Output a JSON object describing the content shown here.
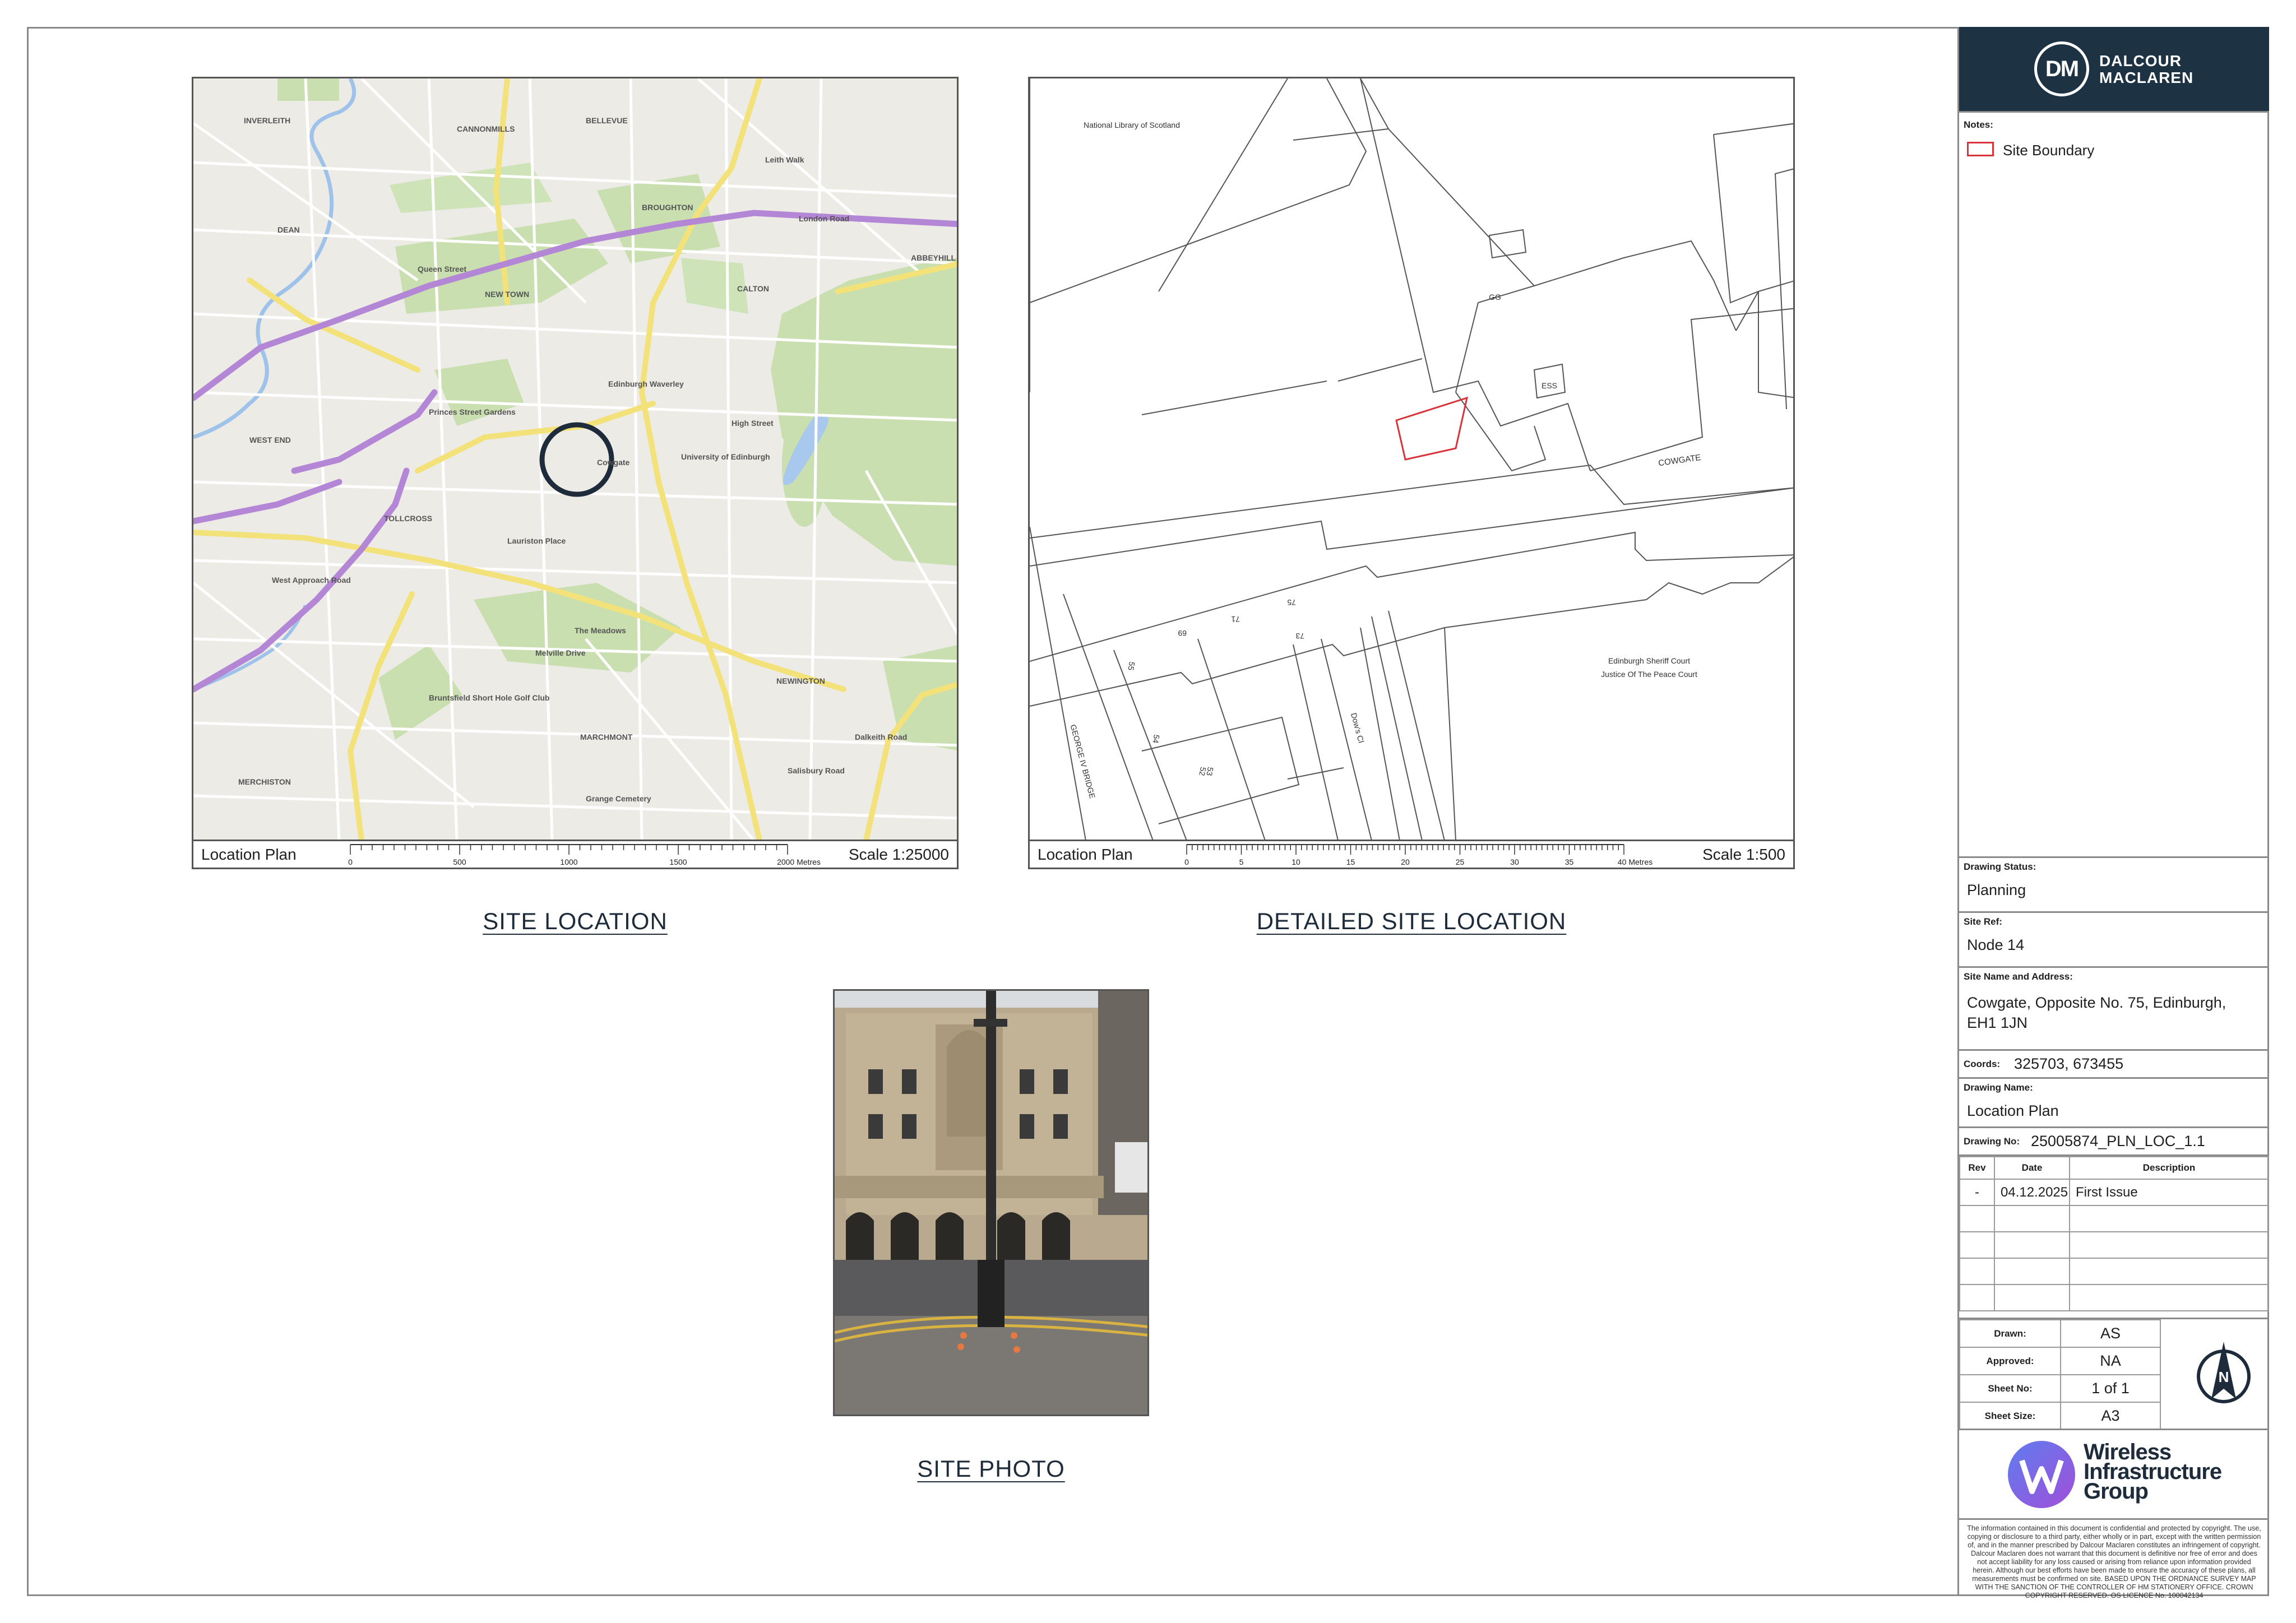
{
  "site_location": {
    "title": "SITE LOCATION",
    "plan_label": "Location Plan",
    "scale_label": "Scale 1:25000",
    "scale_ticks": [
      "0",
      "500",
      "1000",
      "1500",
      "2000 Metres"
    ],
    "map_labels": [
      "INVERLEITH",
      "CANNONMILLS",
      "BELLEVUE",
      "BROUGHTON",
      "DEAN",
      "NEW TOWN",
      "CALTON",
      "ABBEYHILL",
      "WEST END",
      "Princes Street Gardens",
      "Edinburgh Waverley",
      "University of Edinburgh",
      "TOLLCROSS",
      "The Meadows",
      "NEWINGTON",
      "MARCHMONT",
      "MERCHISTON",
      "Bruntsfield Short Hole Golf Club",
      "Queen Street",
      "Leith Walk",
      "London Road",
      "High Street",
      "Cowgate",
      "West Approach Road",
      "Melville Drive",
      "Grange Cemetery",
      "Lauriston Place",
      "Dalkeith Road",
      "Salisbury Road"
    ]
  },
  "detailed_location": {
    "title": "DETAILED SITE LOCATION",
    "plan_label": "Location Plan",
    "scale_label": "Scale 1:500",
    "scale_ticks": [
      "0",
      "5",
      "10",
      "15",
      "20",
      "25",
      "30",
      "35",
      "40 Metres"
    ],
    "map_labels": {
      "library": "National Library of Scotland",
      "gg": "GG",
      "ess": "ESS",
      "cowgate": "COWGATE",
      "court1": "Edinburgh Sheriff Court",
      "court2": "Justice Of The Peace Court",
      "bridge": "GEORGE IV BRIDGE",
      "close": "Dow's Cl",
      "n55": "55",
      "n69": "69",
      "n71": "71",
      "n75": "75",
      "n73": "73",
      "n54": "54",
      "n53": "53",
      "n52": "52"
    }
  },
  "site_photo": {
    "title": "SITE PHOTO"
  },
  "title_block": {
    "company": [
      "DALCOUR",
      "MACLAREN"
    ],
    "logo_mark": "DM",
    "notes_label": "Notes:",
    "legend_site_boundary": "Site Boundary",
    "drawing_status_label": "Drawing Status:",
    "drawing_status": "Planning",
    "site_ref_label": "Site Ref:",
    "site_ref": "Node 14",
    "site_name_label": "Site Name and Address:",
    "site_name_line1": "Cowgate, Opposite No. 75, Edinburgh,",
    "site_name_line2": "EH1 1JN",
    "coords_label": "Coords:",
    "coords": "325703, 673455",
    "drawing_name_label": "Drawing Name:",
    "drawing_name": "Location Plan",
    "drawing_no_label": "Drawing No:",
    "drawing_no": "25005874_PLN_LOC_1.1",
    "rev_headers": [
      "Rev",
      "Date",
      "Description"
    ],
    "revisions": [
      {
        "rev": "-",
        "date": "04.12.2025",
        "desc": "First Issue"
      }
    ],
    "drawn_label": "Drawn:",
    "drawn": "AS",
    "approved_label": "Approved:",
    "approved": "NA",
    "sheet_no_label": "Sheet No:",
    "sheet_no": "1 of 1",
    "sheet_size_label": "Sheet Size:",
    "sheet_size": "A3",
    "north_letter": "N",
    "partner": [
      "Wireless",
      "Infrastructure",
      "Group"
    ],
    "disclaimer": "The information contained in this document is confidential and protected by copyright. The use, copying or disclosure to a third party, either wholly or in part, except with the written permission of, and in the manner prescribed by Dalcour Maclaren constitutes an infringement of copyright. Dalcour Maclaren does not warrant that this document is definitive nor free of error and does not accept liability for any loss caused or arising from reliance upon information provided herein. Although our best efforts have been made to ensure the accuracy of these plans, all measurements must be confirmed on site. BASED UPON THE ORDNANCE SURVEY MAP WITH THE SANCTION OF THE CONTROLLER OF HM STATIONERY OFFICE. CROWN COPYRIGHT RESERVED. OS LICENCE No. 100042134"
  },
  "colors": {
    "brand_navy": "#1d3343",
    "site_boundary_red": "#d8333b",
    "map_green": "#c9dfb0",
    "map_road_yellow": "#f3e27a",
    "map_purple_route": "#b486d6"
  }
}
